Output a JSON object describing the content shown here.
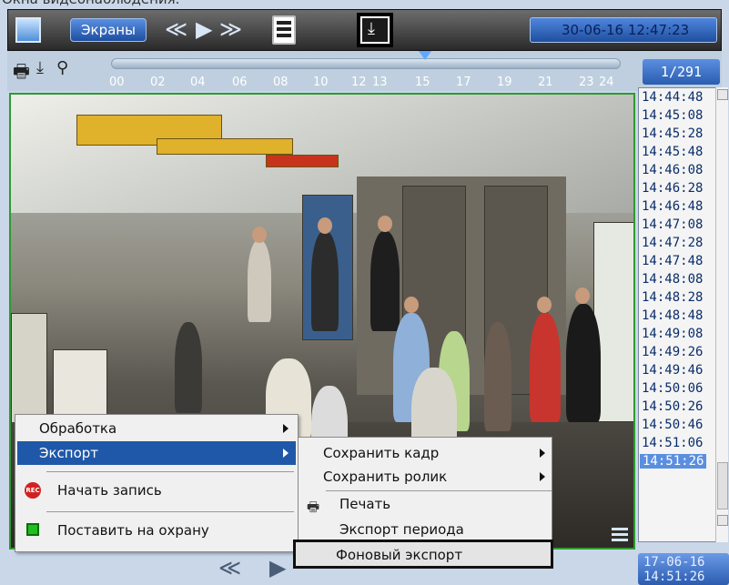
{
  "caption": "Окна видеонаблюдения.",
  "toolbar": {
    "screens_label": "Экраны",
    "rewind_glyph": "≪",
    "play_glyph": "▶",
    "forward_glyph": "≫",
    "export_glyph": "⤓",
    "datetime": "30-06-16  12:47:23"
  },
  "timeline": {
    "ticks": [
      "00",
      "02",
      "04",
      "06",
      "08",
      "10",
      "12",
      "13",
      "15",
      "17",
      "19",
      "21",
      "23",
      "24"
    ],
    "frame_counter": "1/291"
  },
  "time_list": {
    "items": [
      "14:44:48",
      "14:45:08",
      "14:45:28",
      "14:45:48",
      "14:46:08",
      "14:46:28",
      "14:46:48",
      "14:47:08",
      "14:47:28",
      "14:47:48",
      "14:48:08",
      "14:48:28",
      "14:48:48",
      "14:49:08",
      "14:49:26",
      "14:49:46",
      "14:50:06",
      "14:50:26",
      "14:50:46",
      "14:51:06",
      "14:51:26"
    ],
    "selected": "14:51:26"
  },
  "date_box": {
    "date": "17-06-16",
    "time": "14:51:26"
  },
  "bottom": {
    "rewind": "≪",
    "play": "▶"
  },
  "context_menu": {
    "processing": "Обработка",
    "export": "Экспорт",
    "start_recording": "Начать запись",
    "rec_icon_text": "REC",
    "arm": "Поставить на охрану"
  },
  "export_submenu": {
    "save_frame": "Сохранить кадр",
    "save_clip": "Сохранить ролик",
    "print": "Печать",
    "export_period": "Экспорт периода",
    "background_export": "Фоновый экспорт"
  },
  "colors": {
    "accent": "#1f58a8",
    "video_border": "#2e9a2e",
    "selected_time": "#5a8fe0"
  }
}
